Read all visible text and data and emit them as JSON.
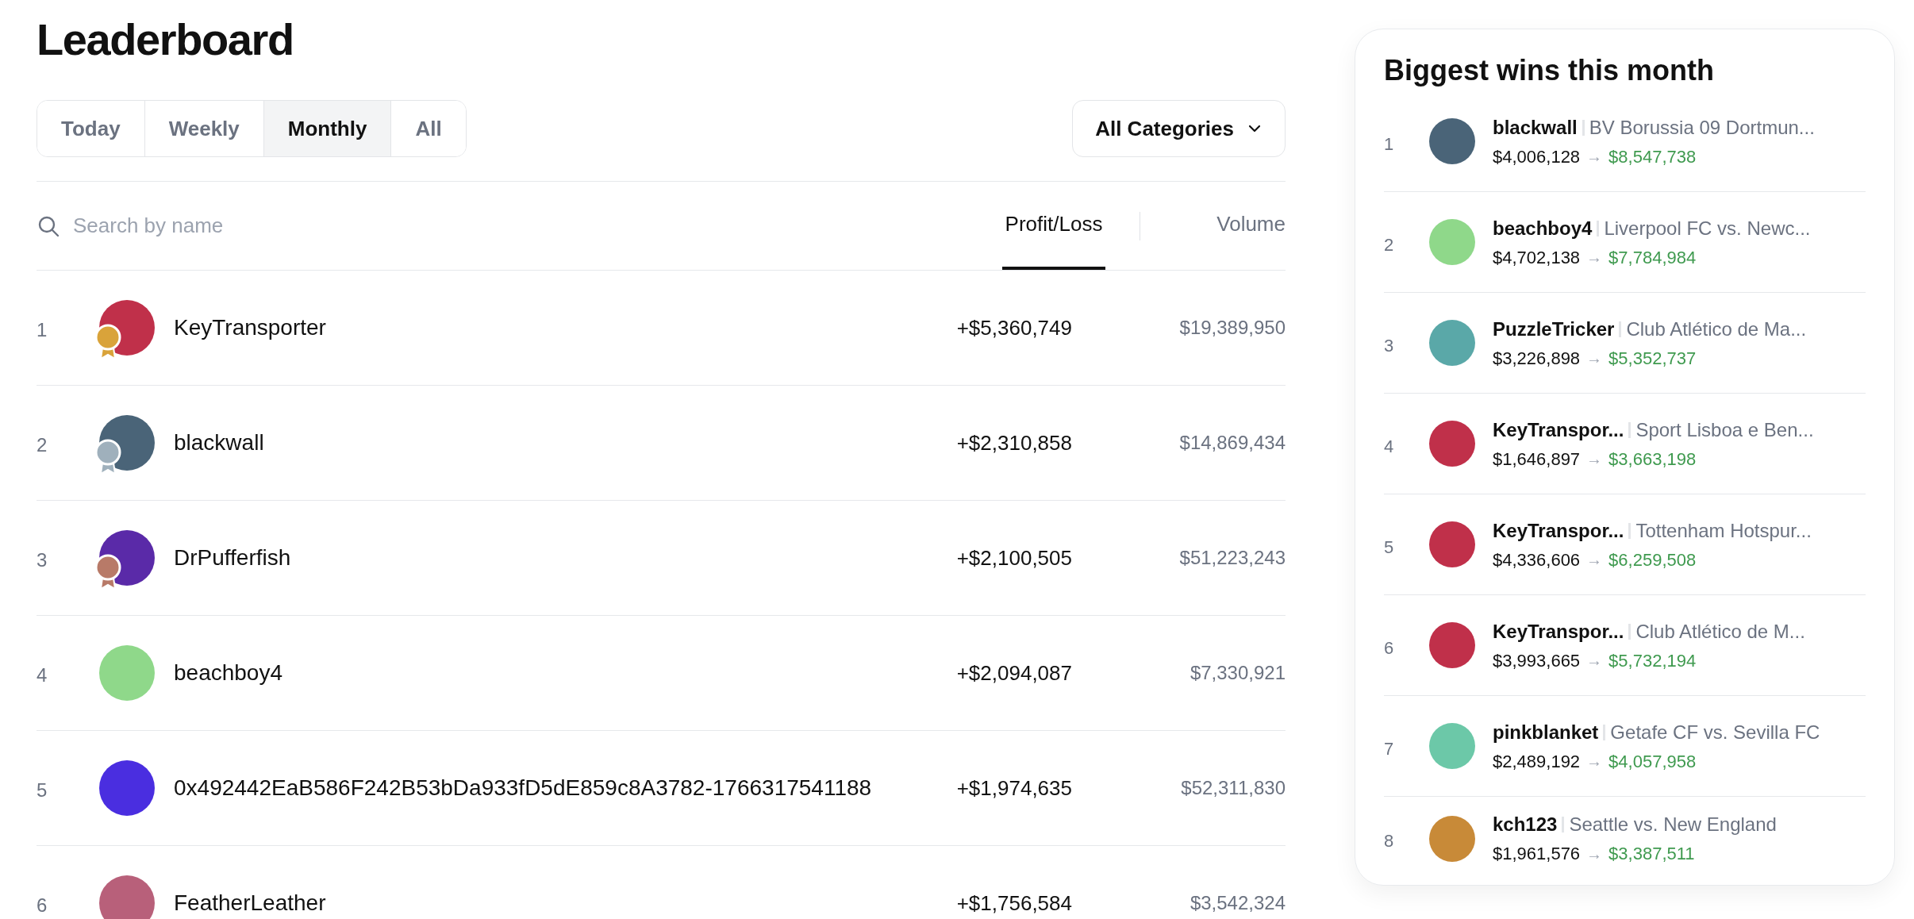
{
  "title": "Leaderboard",
  "periods": [
    {
      "label": "Today",
      "selected": false
    },
    {
      "label": "Weekly",
      "selected": false
    },
    {
      "label": "Monthly",
      "selected": true
    },
    {
      "label": "All",
      "selected": false
    }
  ],
  "category_filter": {
    "label": "All Categories"
  },
  "search": {
    "placeholder": "Search by name"
  },
  "sort_columns": [
    {
      "label": "Profit/Loss",
      "selected": true
    },
    {
      "label": "Volume",
      "selected": false
    }
  ],
  "rows": [
    {
      "rank": "1",
      "name": "KeyTransporter",
      "medal": {
        "color": "#d9a33a"
      },
      "color": "#c0304a",
      "profit_loss": "+$5,360,749",
      "volume": "$19,389,950"
    },
    {
      "rank": "2",
      "name": "blackwall",
      "medal": {
        "color": "#9fb0bc"
      },
      "color": "#4a6478",
      "profit_loss": "+$2,310,858",
      "volume": "$14,869,434"
    },
    {
      "rank": "3",
      "name": "DrPufferfish",
      "medal": {
        "color": "#b87a68"
      },
      "color": "#5a2aa8",
      "profit_loss": "+$2,100,505",
      "volume": "$51,223,243"
    },
    {
      "rank": "4",
      "name": "beachboy4",
      "color": "#8fd88a",
      "profit_loss": "+$2,094,087",
      "volume": "$7,330,921"
    },
    {
      "rank": "5",
      "name": "0x492442EaB586F242B53bDa933fD5dE859c8A3782-1766317541188",
      "color": "#4a2ee0",
      "profit_loss": "+$1,974,635",
      "volume": "$52,311,830"
    },
    {
      "rank": "6",
      "name": "FeatherLeather",
      "color": "#b8607a",
      "profit_loss": "+$1,756,584",
      "volume": "$3,542,324"
    }
  ],
  "biggest_wins": {
    "title": "Biggest wins this month",
    "items": [
      {
        "rank": "1",
        "name": "blackwall",
        "market": "BV Borussia 09 Dortmun...",
        "color": "#4a6478",
        "from": "$4,006,128",
        "arrow": "→",
        "to": "$8,547,738"
      },
      {
        "rank": "2",
        "name": "beachboy4",
        "market": "Liverpool FC vs. Newc...",
        "color": "#8fd88a",
        "from": "$4,702,138",
        "arrow": "→",
        "to": "$7,784,984"
      },
      {
        "rank": "3",
        "name": "PuzzleTricker",
        "market": "Club Atlético de Ma...",
        "color": "#5aa8a8",
        "from": "$3,226,898",
        "arrow": "→",
        "to": "$5,352,737"
      },
      {
        "rank": "4",
        "name": "KeyTranspor...",
        "market": "Sport Lisboa e Ben...",
        "color": "#c0304a",
        "from": "$1,646,897",
        "arrow": "→",
        "to": "$3,663,198"
      },
      {
        "rank": "5",
        "name": "KeyTranspor...",
        "market": "Tottenham Hotspur...",
        "color": "#c0304a",
        "from": "$4,336,606",
        "arrow": "→",
        "to": "$6,259,508"
      },
      {
        "rank": "6",
        "name": "KeyTranspor...",
        "market": "Club Atlético de M...",
        "color": "#c0304a",
        "from": "$3,993,665",
        "arrow": "→",
        "to": "$5,732,194"
      },
      {
        "rank": "7",
        "name": "pinkblanket",
        "market": "Getafe CF vs. Sevilla FC",
        "color": "#6cc8a8",
        "from": "$2,489,192",
        "arrow": "→",
        "to": "$4,057,958"
      },
      {
        "rank": "8",
        "name": "kch123",
        "market": "Seattle vs. New England",
        "color": "#c88a38",
        "from": "$1,961,576",
        "arrow": "→",
        "to": "$3,387,511"
      }
    ]
  }
}
